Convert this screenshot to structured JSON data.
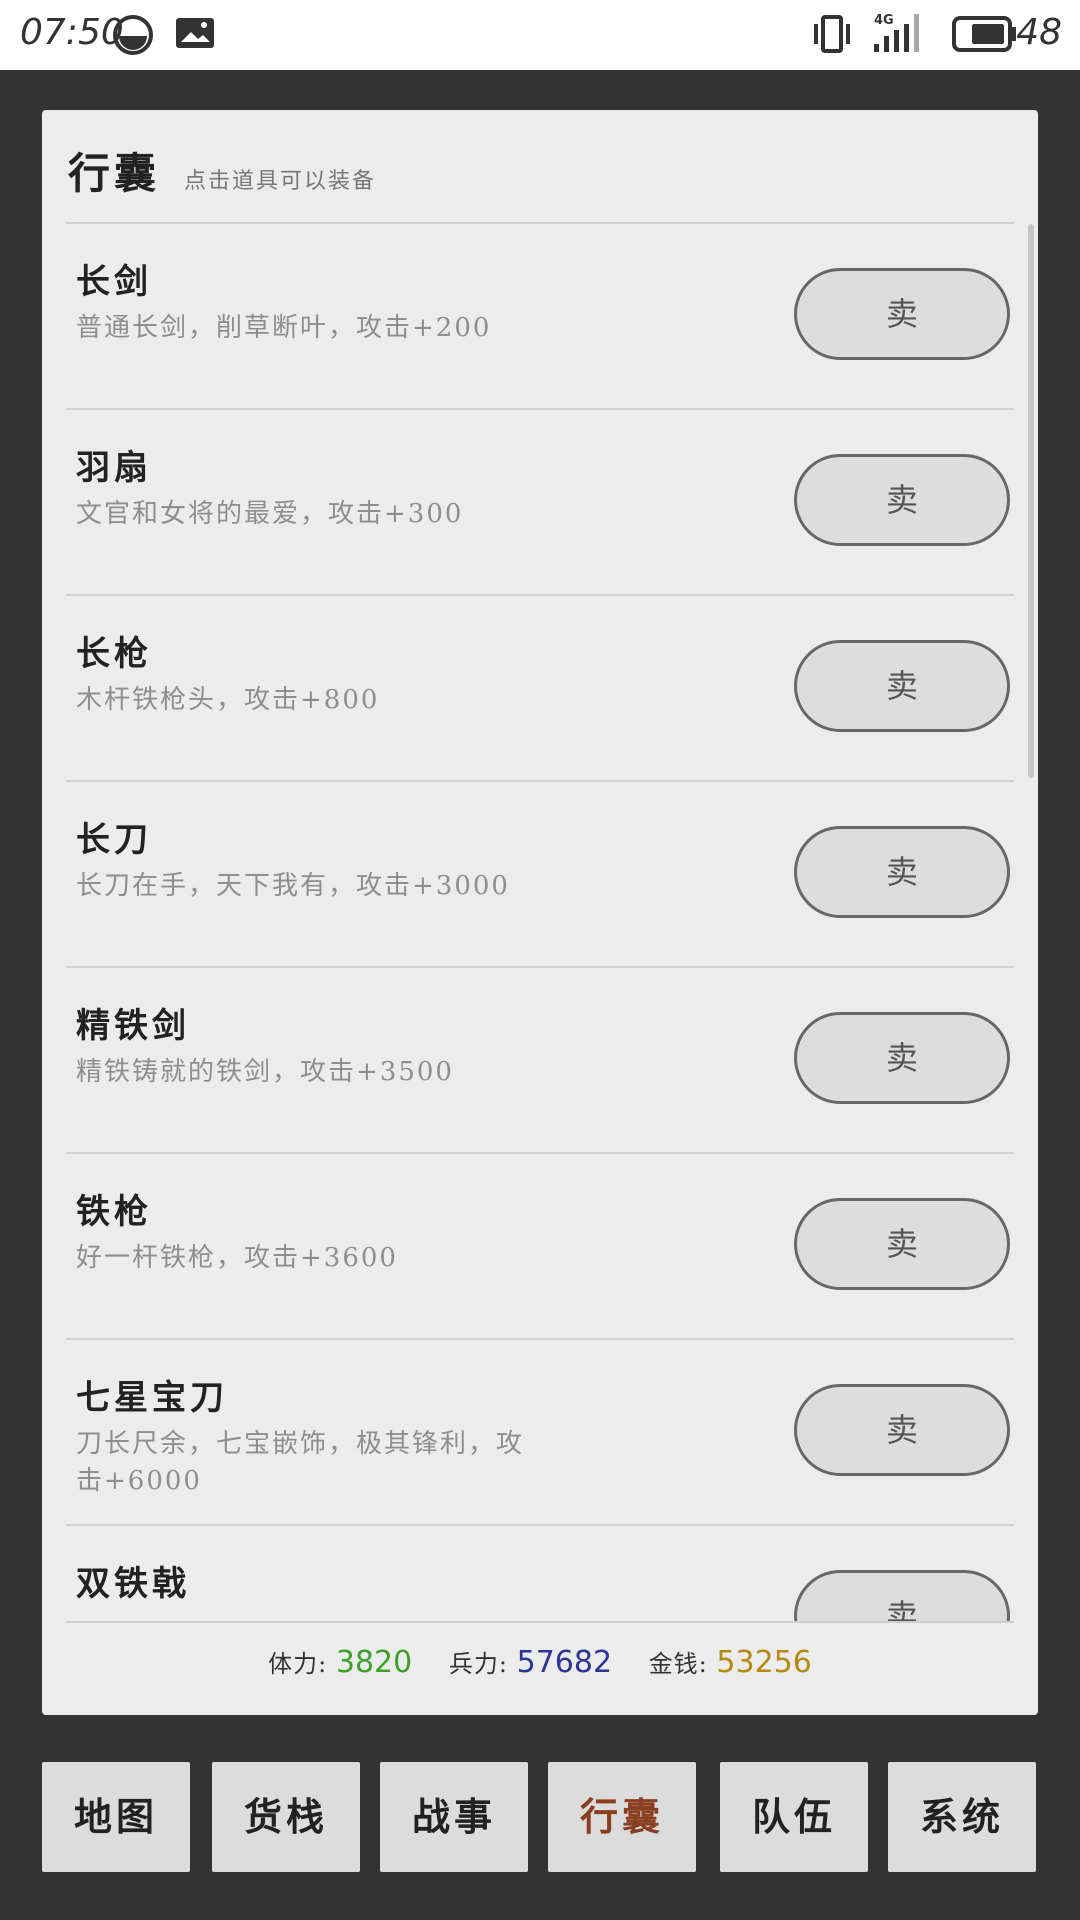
{
  "status_bar": {
    "time": "07:50",
    "icons": [
      "data-saver-icon",
      "image-notification-icon",
      "vibrate-icon",
      "signal-4g-icon",
      "battery-icon"
    ],
    "network_label": "4G",
    "battery_level": "48"
  },
  "panel": {
    "title": "行囊",
    "hint": "点击道具可以装备"
  },
  "items": [
    {
      "name": "长剑",
      "desc": "普通长剑，削草断叶，攻击+200",
      "sell_label": "卖"
    },
    {
      "name": "羽扇",
      "desc": "文官和女将的最爱，攻击+300",
      "sell_label": "卖"
    },
    {
      "name": "长枪",
      "desc": "木杆铁枪头，攻击+800",
      "sell_label": "卖"
    },
    {
      "name": "长刀",
      "desc": "长刀在手，天下我有，攻击+3000",
      "sell_label": "卖"
    },
    {
      "name": "精铁剑",
      "desc": "精铁铸就的铁剑，攻击+3500",
      "sell_label": "卖"
    },
    {
      "name": "铁枪",
      "desc": "好一杆铁枪，攻击+3600",
      "sell_label": "卖"
    },
    {
      "name": "七星宝刀",
      "desc": "刀长尺余，七宝嵌饰，极其锋利，攻击+6000",
      "sell_label": "卖"
    },
    {
      "name": "双铁戟",
      "desc": "",
      "sell_label": "卖"
    }
  ],
  "stats": {
    "stamina_label": "体力:",
    "stamina_value": "3820",
    "troops_label": "兵力:",
    "troops_value": "57682",
    "gold_label": "金钱:",
    "gold_value": "53256"
  },
  "nav": [
    {
      "label": "地图",
      "active": false
    },
    {
      "label": "货栈",
      "active": false
    },
    {
      "label": "战事",
      "active": false
    },
    {
      "label": "行囊",
      "active": true
    },
    {
      "label": "队伍",
      "active": false
    },
    {
      "label": "系统",
      "active": false
    }
  ],
  "colors": {
    "stamina": "#3ea028",
    "troops": "#2c3594",
    "gold": "#b48a12",
    "active_nav": "#8a3f22",
    "background": "#333333",
    "panel": "#ececec"
  }
}
